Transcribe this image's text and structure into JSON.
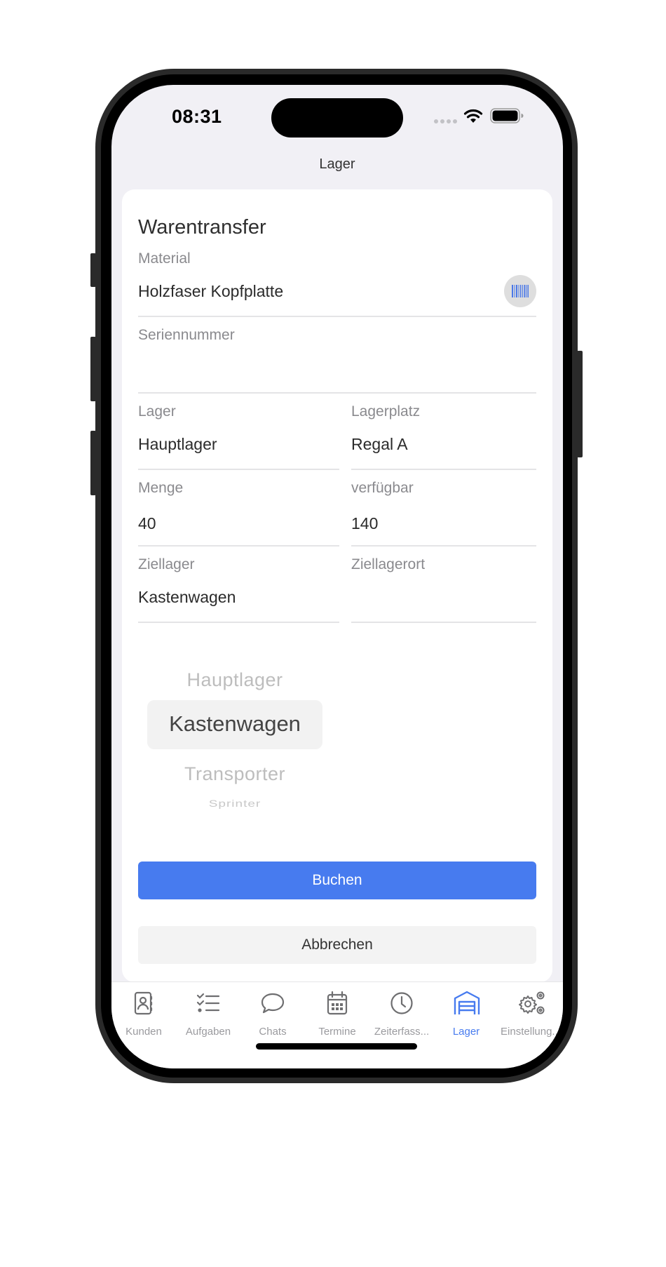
{
  "status_bar": {
    "time": "08:31"
  },
  "nav": {
    "title": "Lager"
  },
  "form": {
    "title": "Warentransfer",
    "material": {
      "label": "Material",
      "value": "Holzfaser Kopfplatte",
      "scan_icon": "barcode-icon"
    },
    "serial": {
      "label": "Seriennummer",
      "value": ""
    },
    "lager": {
      "label": "Lager",
      "value": "Hauptlager"
    },
    "lagerplatz": {
      "label": "Lagerplatz",
      "value": "Regal A"
    },
    "menge": {
      "label": "Menge",
      "value": "40"
    },
    "verfuegbar": {
      "label": "verfügbar",
      "value": "140"
    },
    "ziellager": {
      "label": "Ziellager",
      "value": "Kastenwagen"
    },
    "ziellagerort": {
      "label": "Ziellagerort",
      "value": ""
    }
  },
  "picker": {
    "options": [
      "Hauptlager",
      "Kastenwagen",
      "Transporter",
      "Sprinter"
    ],
    "selected": "Kastenwagen"
  },
  "actions": {
    "book_label": "Buchen",
    "cancel_label": "Abbrechen"
  },
  "colors": {
    "accent": "#477bef",
    "background": "#f1f0f5"
  },
  "tabbar": {
    "items": [
      {
        "label": "Kunden",
        "icon": "contacts-book-icon"
      },
      {
        "label": "Aufgaben",
        "icon": "checklist-icon"
      },
      {
        "label": "Chats",
        "icon": "chat-bubble-icon"
      },
      {
        "label": "Termine",
        "icon": "calendar-icon"
      },
      {
        "label": "Zeiterfass...",
        "icon": "clock-icon"
      },
      {
        "label": "Lager",
        "icon": "warehouse-icon",
        "active": true
      },
      {
        "label": "Einstellung...",
        "icon": "gears-icon"
      }
    ]
  }
}
